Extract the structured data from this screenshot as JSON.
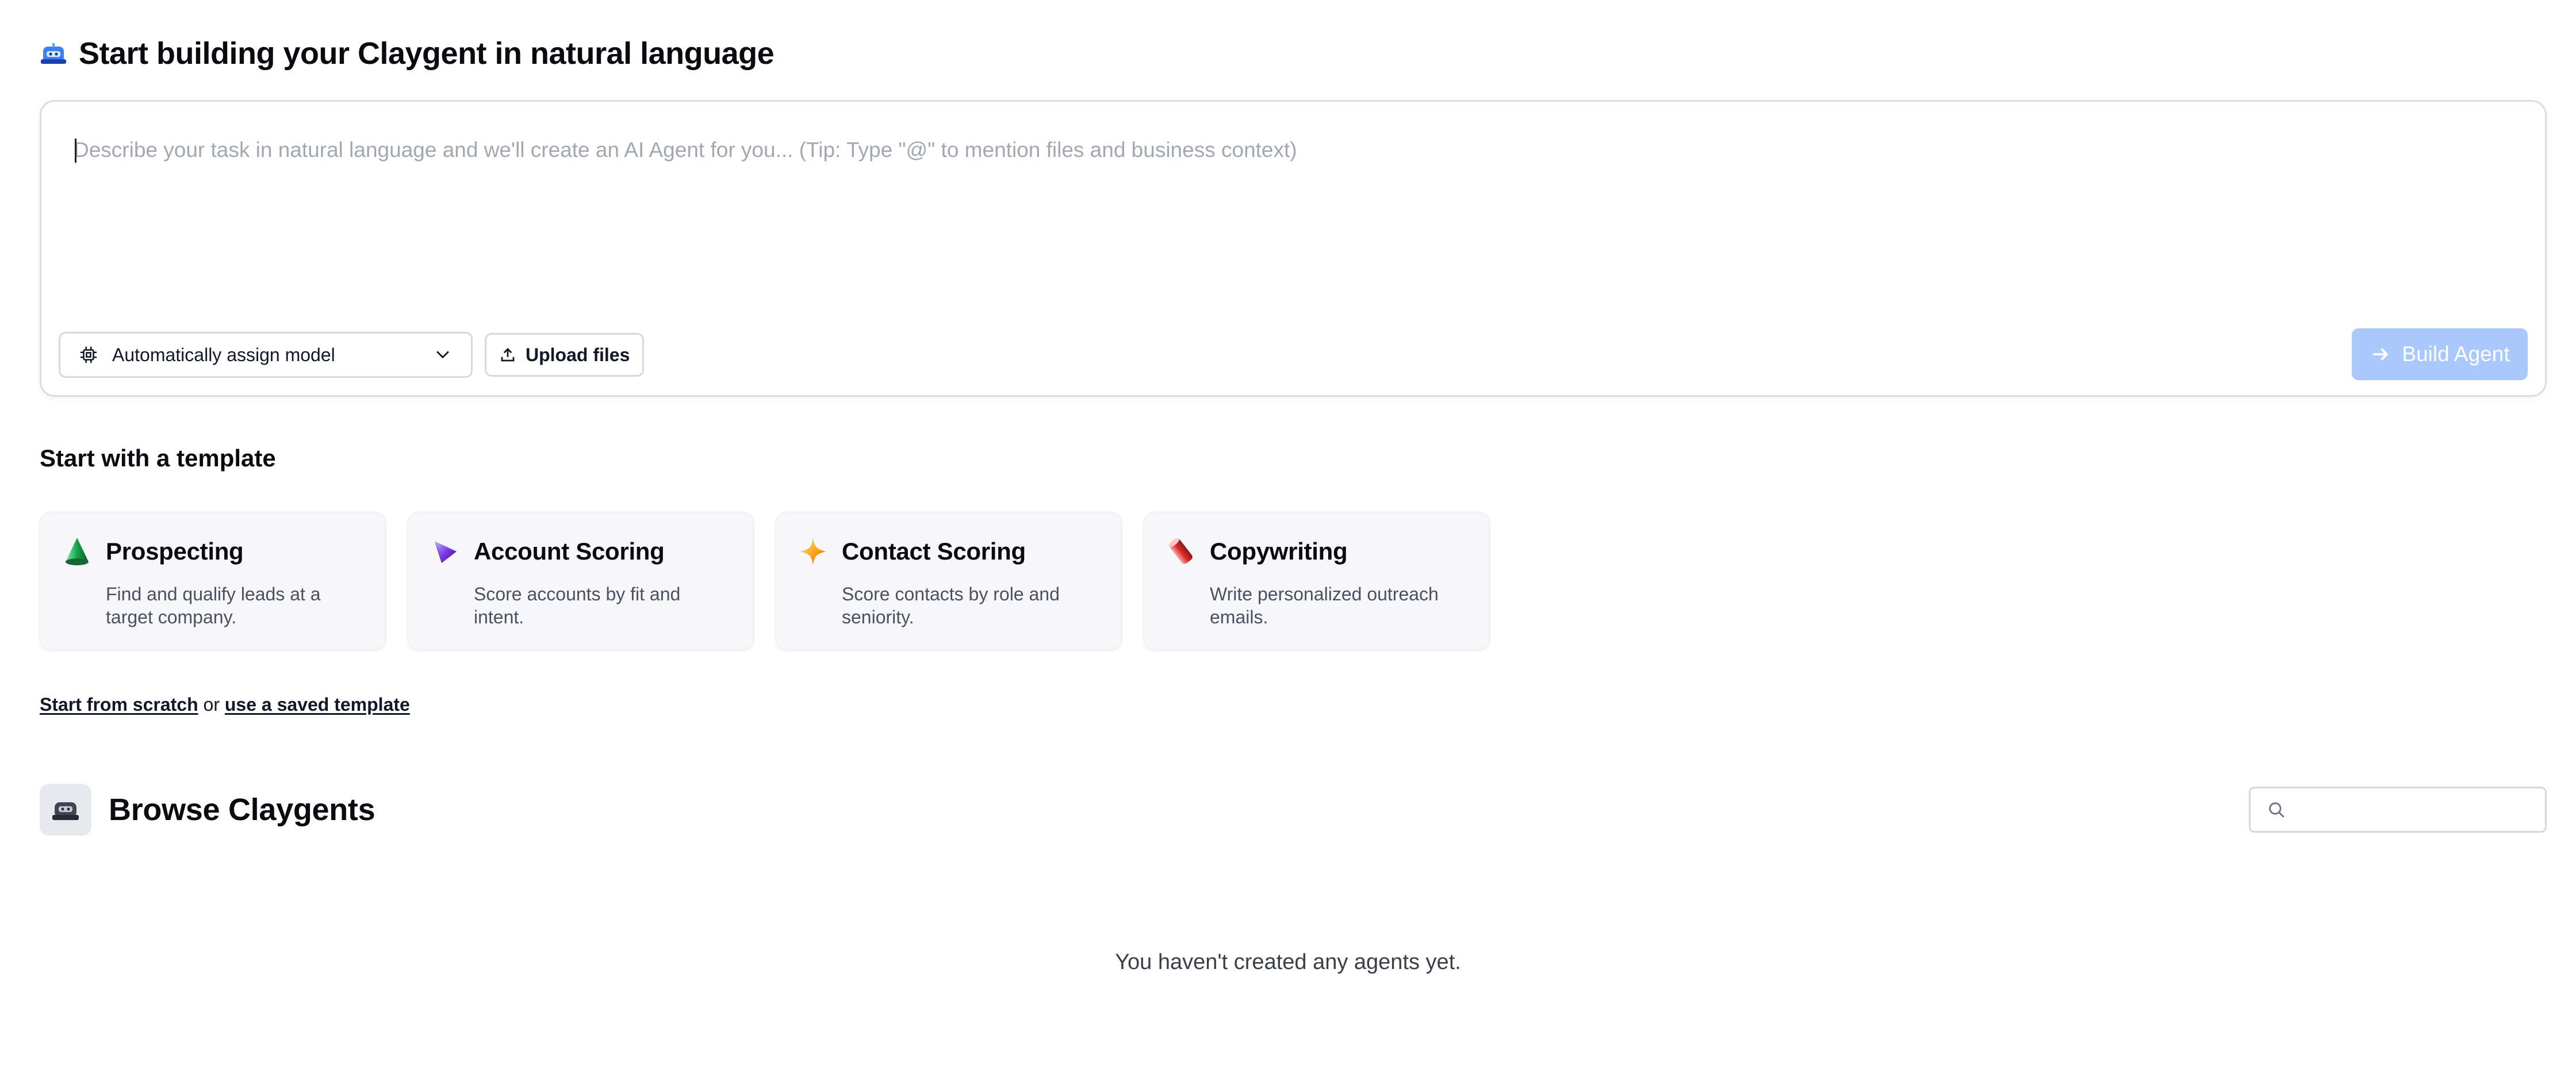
{
  "builder": {
    "title": "Start building your Claygent in natural language",
    "prompt_placeholder": "Describe your task in natural language and we'll create an AI Agent for you... (Tip: Type \"@\" to mention files and business context)",
    "prompt_value": "",
    "model_select": "Automatically assign model",
    "upload_label": "Upload files",
    "build_label": "Build Agent",
    "build_color": "#a9c8fb"
  },
  "templates": {
    "heading": "Start with a template",
    "items": [
      {
        "title": "Prospecting",
        "description": "Find and qualify leads at a target company.",
        "icon": "green-cone-icon"
      },
      {
        "title": "Account Scoring",
        "description": "Score accounts by fit and intent.",
        "icon": "purple-prism-icon"
      },
      {
        "title": "Contact Scoring",
        "description": "Score contacts by role and seniority.",
        "icon": "gold-sparkle-icon"
      },
      {
        "title": "Copywriting",
        "description": "Write personalized outreach emails.",
        "icon": "red-cylinder-icon"
      }
    ],
    "scratch_link": "Start from scratch",
    "or_text": "or",
    "saved_template_link": "use a saved template"
  },
  "browse": {
    "title": "Browse Claygents",
    "search_placeholder": "",
    "empty_text": "You haven't created any agents yet."
  }
}
